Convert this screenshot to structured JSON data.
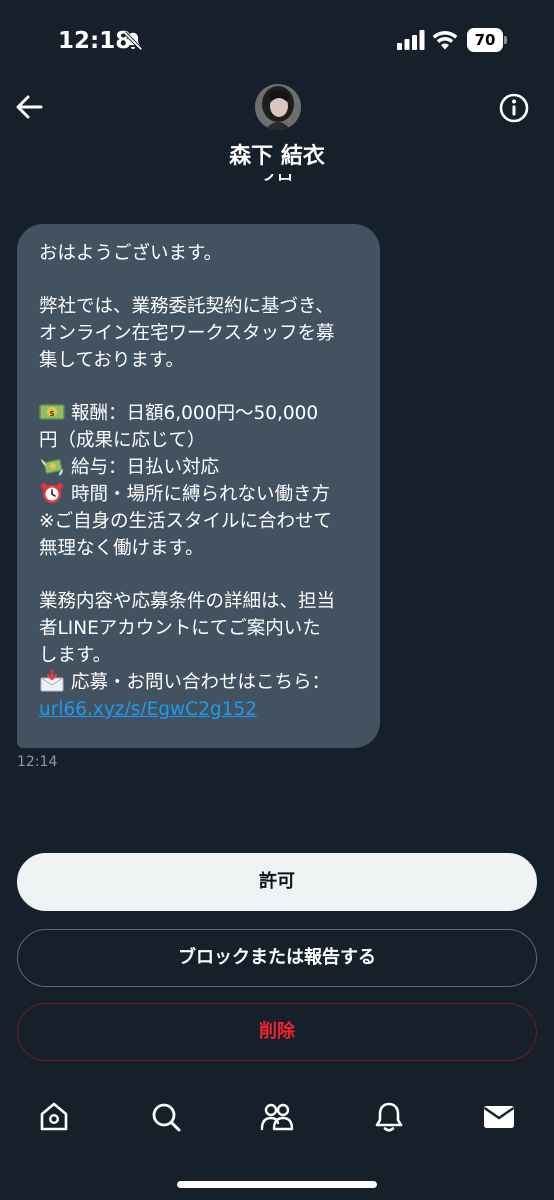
{
  "status_bar": {
    "time": "12:18",
    "battery": "70",
    "icons": [
      "bell-slash-icon",
      "cellular-signal-icon",
      "wifi-icon",
      "battery-icon"
    ]
  },
  "header": {
    "contact_name": "森下 結衣",
    "contact_sub": "フロ",
    "icons": [
      "back-arrow-icon",
      "avatar",
      "info-icon"
    ]
  },
  "message": {
    "lines": [
      "おはようございます。",
      "",
      "弊社では、業務委託契約に基づき、",
      "オンライン在宅ワークスタッフを募",
      "集しております。",
      "",
      "報酬：日額6,000円～50,000",
      "円（成果に応じて）",
      "給与：日払い対応",
      "時間・場所に縛られない働き方",
      "※ご自身の生活スタイルに合わせて",
      "無理なく働けます。",
      "",
      "業務内容や応募条件の詳細は、担当",
      "者LINEアカウントにてご案内いた",
      "します。",
      "応募・お問い合わせはこちら："
    ],
    "emojis": [
      "dollar-banknote-icon",
      "money-with-wings-icon",
      "alarm-clock-icon",
      "incoming-envelope-icon"
    ],
    "link": "url66.xyz/s/EgwC2g152",
    "timestamp": "12:14"
  },
  "actions": {
    "allow": "許可",
    "block": "ブロックまたは報告する",
    "delete": "削除"
  },
  "nav": {
    "items": [
      "home-icon",
      "search-icon",
      "communities-icon",
      "notifications-icon",
      "messages-icon"
    ]
  },
  "colors": {
    "background": "#15202b",
    "bubble": "#425260",
    "link": "#1d9bf0",
    "danger": "#f4212e",
    "allow_button": "#eff3f4"
  }
}
